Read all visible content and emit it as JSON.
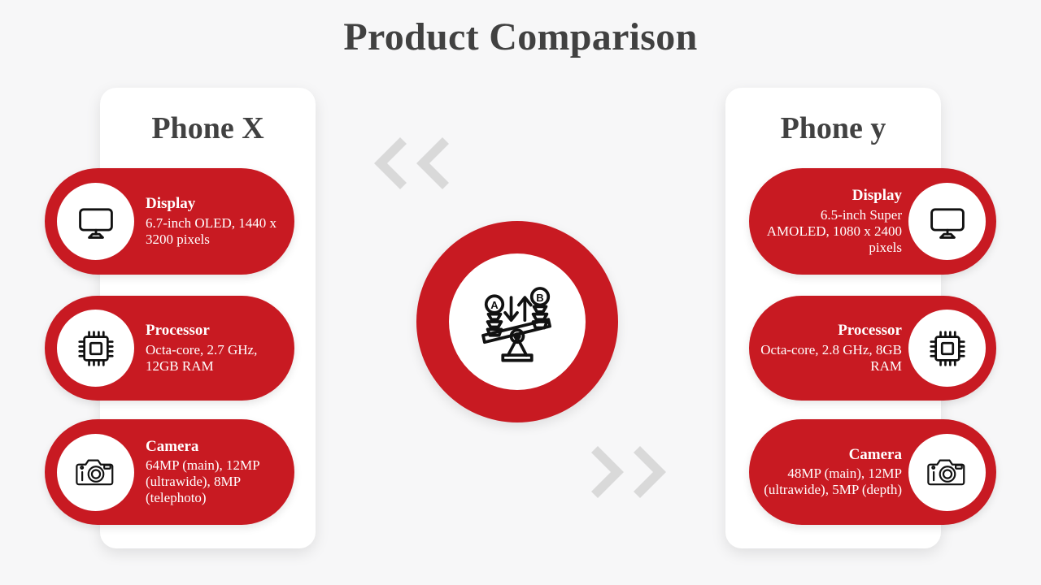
{
  "slide": {
    "title": "Product Comparison",
    "background_color": "#f7f7f8",
    "accent_color": "#c81a22",
    "title_color": "#414141",
    "chevron_color": "#d9d9d9"
  },
  "center_emblem": {
    "icon": "balance-scale-comparison-icon",
    "ring_color": "#c81a22",
    "inner_color": "#ffffff",
    "labels": {
      "left_token": "A",
      "right_token": "B"
    }
  },
  "chevrons": {
    "left": {
      "name": "chevron-double-left-icon",
      "direction": "left",
      "count": 2
    },
    "right": {
      "name": "chevron-double-right-icon",
      "direction": "right",
      "count": 2
    }
  },
  "products": [
    {
      "id": "phone-x",
      "name": "Phone X",
      "side": "left",
      "specs": [
        {
          "icon": "display-monitor-icon",
          "label": "Display",
          "value": " 6.7-inch OLED, 1440 x 3200 pixels"
        },
        {
          "icon": "processor-chip-icon",
          "label": "Processor",
          "value": "Octa-core, 2.7 GHz, 12GB RAM"
        },
        {
          "icon": "camera-icon",
          "label": "Camera",
          "value": " 64MP (main), 12MP (ultrawide), 8MP (telephoto)"
        }
      ]
    },
    {
      "id": "phone-y",
      "name": "Phone y",
      "side": "right",
      "specs": [
        {
          "icon": "display-monitor-icon",
          "label": "Display",
          "value": "6.5-inch Super AMOLED, 1080 x 2400 pixels"
        },
        {
          "icon": "processor-chip-icon",
          "label": "Processor",
          "value": "Octa-core, 2.8 GHz, 8GB RAM"
        },
        {
          "icon": "camera-icon",
          "label": "Camera",
          "value": "48MP (main), 12MP (ultrawide), 5MP (depth)"
        }
      ]
    }
  ]
}
